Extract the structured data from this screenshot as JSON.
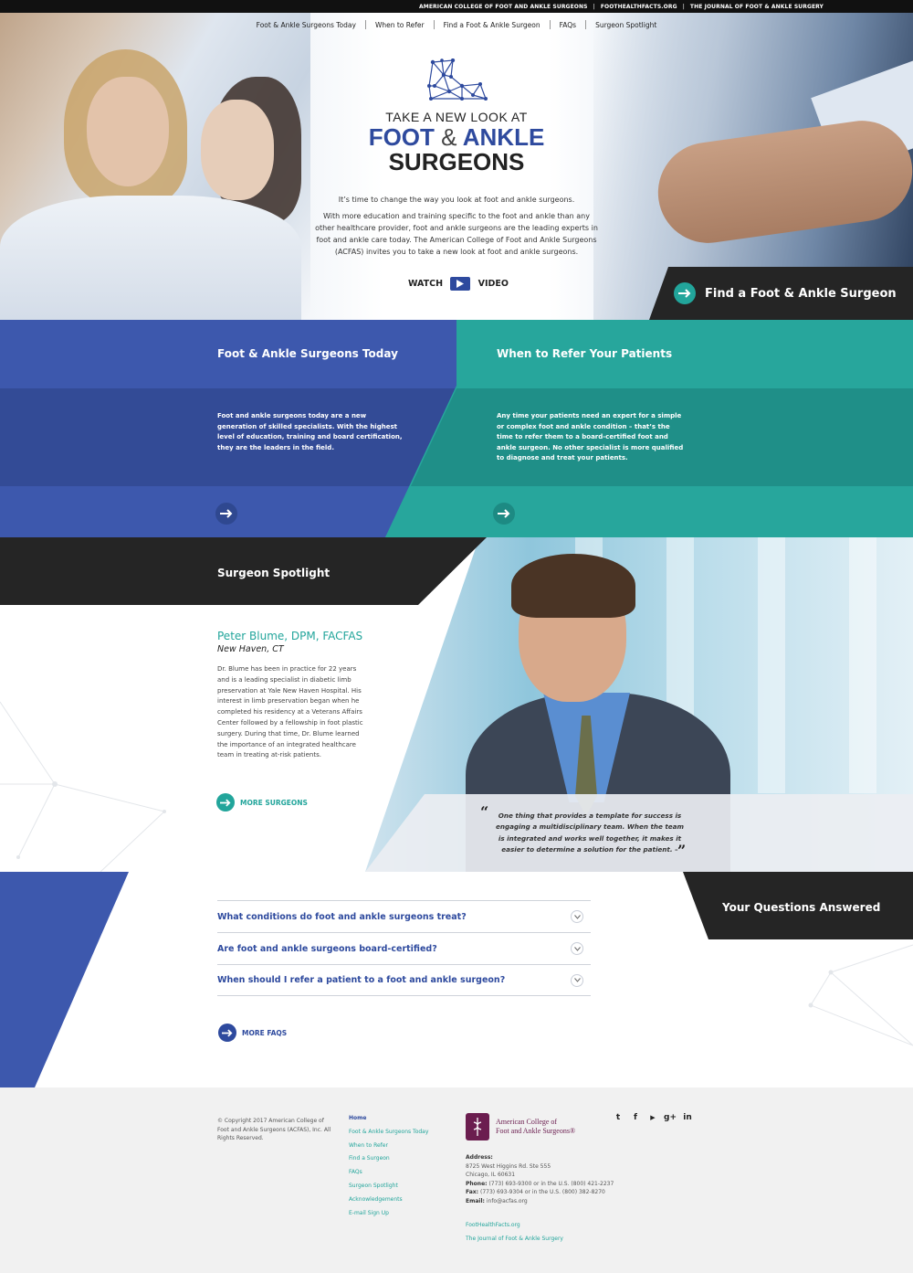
{
  "topbar": {
    "links": [
      "AMERICAN COLLEGE OF FOOT AND ANKLE SURGEONS",
      "FOOTHEALTHFACTS.ORG",
      "THE JOURNAL OF FOOT & ANKLE SURGERY"
    ],
    "separator": "|"
  },
  "nav": {
    "items": [
      "Foot & Ankle Surgeons Today",
      "When to Refer",
      "Find a Foot & Ankle Surgeon",
      "FAQs",
      "Surgeon Spotlight"
    ]
  },
  "hero": {
    "line1": "TAKE A NEW LOOK AT",
    "line2a": "FOOT",
    "line2amp": "&",
    "line2b": "ANKLE",
    "line3": "SURGEONS",
    "intro1": "It’s time to change the way you look at foot and ankle surgeons.",
    "intro2": "With more education and training specific to the foot and ankle than any other healthcare provider, foot and ankle surgeons are the leading experts in foot and ankle care today. The American College of Foot and Ankle Surgeons (ACFAS) invites you to take a new look at foot and ankle surgeons.",
    "watch_left": "WATCH",
    "watch_right": "VIDEO",
    "find_button": "Find a Foot & Ankle Surgeon"
  },
  "cards": {
    "today": {
      "title": "Foot & Ankle Surgeons Today",
      "text": "Foot and ankle surgeons today are a new generation of skilled specialists. With the highest level of education, training and board certification, they are the leaders in the field."
    },
    "refer": {
      "title": "When to Refer Your Patients",
      "text": "Any time your patients need an expert for a simple or complex foot and ankle condition – that’s the time to refer them to a board-certified foot and ankle surgeon. No other specialist is more qualified to diagnose and treat your patients."
    }
  },
  "spotlight": {
    "header": "Surgeon Spotlight",
    "name": "Peter Blume, DPM, FACFAS",
    "location": "New Haven, CT",
    "bio": "Dr. Blume has been in practice for 22 years and is a leading specialist in diabetic limb preservation at Yale New Haven Hospital. His interest in limb preservation began when he completed his residency at a Veterans Affairs Center followed by a fellowship in foot plastic surgery. During that time, Dr. Blume learned the importance of an integrated healthcare team in treating at-risk patients.",
    "more": "MORE SURGEONS",
    "quote": "One thing that provides a template for success is engaging a multidisciplinary team. When the team is integrated and works well together, it makes it easier to determine a solution for the patient. –",
    "quote_open": "“",
    "quote_close": "”"
  },
  "faq": {
    "header": "Your Questions Answered",
    "questions": [
      "What conditions do foot and ankle surgeons treat?",
      "Are foot and ankle surgeons board-certified?",
      "When should I refer a patient to a foot and ankle surgeon?"
    ],
    "more": "MORE FAQS"
  },
  "footer": {
    "copyright": "© Copyright 2017 American College of Foot and Ankle Surgeons (ACFAS), Inc. All Rights Reserved.",
    "links": [
      "Home",
      "Foot & Ankle Surgeons Today",
      "When to Refer",
      "Find a Surgeon",
      "FAQs",
      "Surgeon Spotlight",
      "Acknowledgements",
      "E-mail Sign Up"
    ],
    "org_name_1": "American College of",
    "org_name_2": "Foot and Ankle Surgeons®",
    "address_label": "Address:",
    "address_1": "8725 West Higgins Rd. Ste 555",
    "address_2": "Chicago, IL 60631",
    "phone_label": "Phone:",
    "phone": "(773) 693-9300 or in the U.S. (800) 421-2237",
    "fax_label": "Fax:",
    "fax": "(773) 693-9304 or in the U.S. (800) 382-8270",
    "email_label": "Email:",
    "email": "info@acfas.org",
    "ext_links": [
      "FootHealthFacts.org",
      "The Journal of Foot & Ankle Surgery"
    ],
    "social": [
      "twitter-icon",
      "facebook-icon",
      "youtube-icon",
      "googleplus-icon",
      "linkedin-icon"
    ],
    "social_glyphs": [
      "t",
      "f",
      "▶",
      "g+",
      "in"
    ]
  },
  "colors": {
    "blue": "#3d58ad",
    "teal": "#27a69c",
    "dark": "#252525"
  }
}
